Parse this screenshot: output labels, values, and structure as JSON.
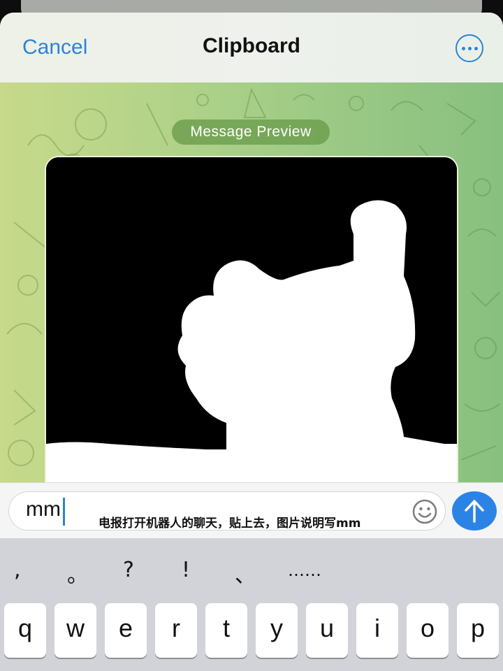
{
  "header": {
    "cancel_label": "Cancel",
    "title": "Clipboard",
    "more_icon": "more-horizontal-icon"
  },
  "chat": {
    "preview_label": "Message Preview",
    "image_description_icon": "photo-icon"
  },
  "composer": {
    "text_value": "mm",
    "overlay_note": "电报打开机器人的聊天，贴上去，图片说明写mm",
    "emoji_icon": "emoji-icon",
    "send_icon": "send-arrow-icon"
  },
  "keyboard": {
    "punctuation": [
      ",",
      "。",
      "?",
      "!",
      "、",
      "……"
    ],
    "letters_row1": [
      "q",
      "w",
      "e",
      "r",
      "t",
      "y",
      "u",
      "i",
      "o",
      "p"
    ]
  },
  "colors": {
    "accent": "#2b83d6",
    "send": "#2b83e6"
  }
}
